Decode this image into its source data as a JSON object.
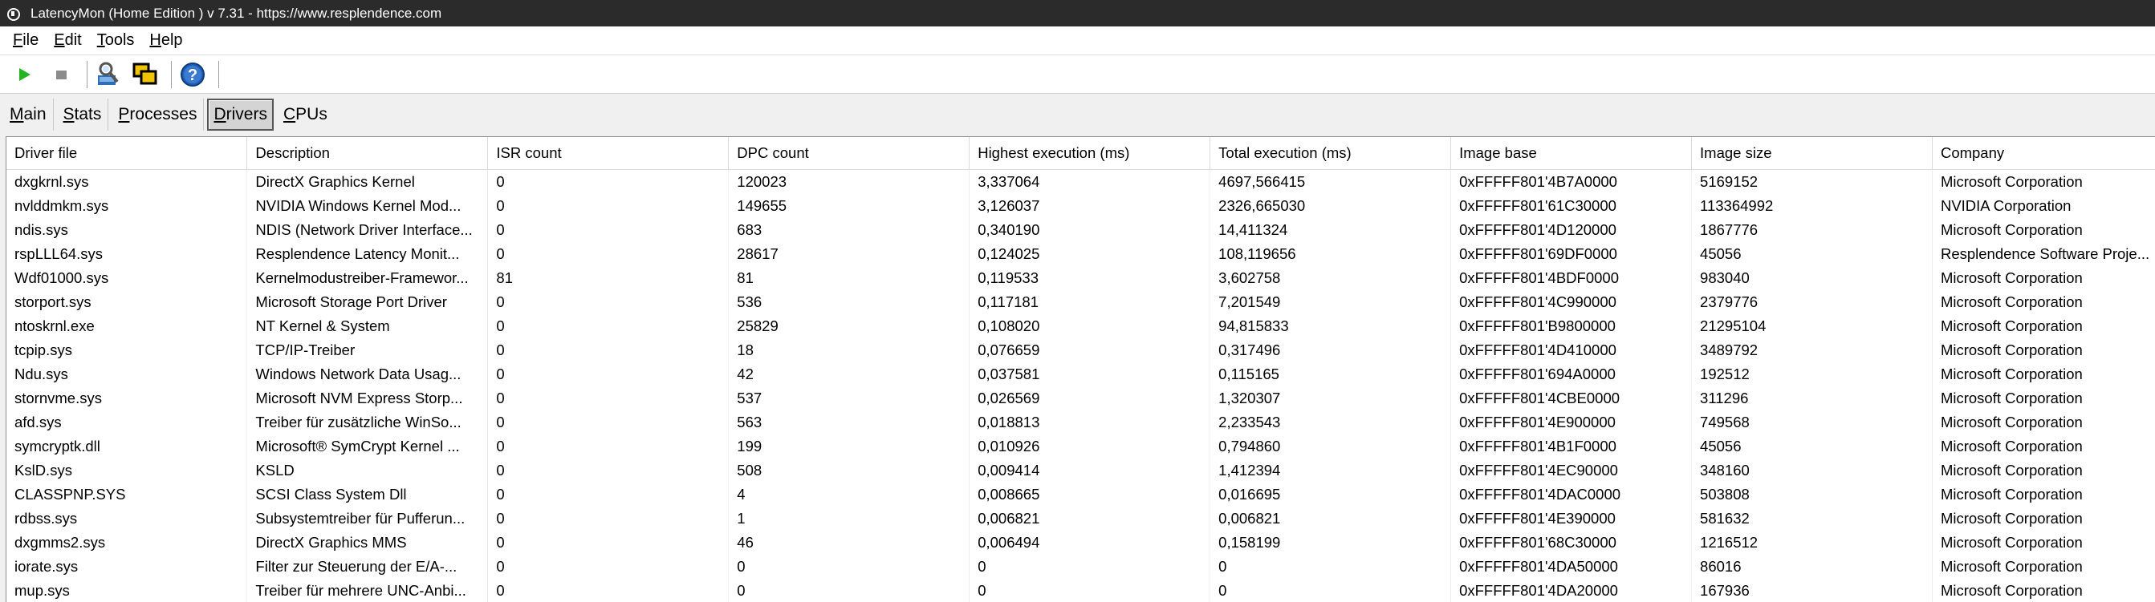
{
  "window": {
    "title": "LatencyMon  (Home Edition )  v 7.31 - https://www.resplendence.com"
  },
  "menu": [
    {
      "accel": "F",
      "rest": "ile"
    },
    {
      "accel": "E",
      "rest": "dit"
    },
    {
      "accel": "T",
      "rest": "ools"
    },
    {
      "accel": "H",
      "rest": "elp"
    }
  ],
  "toolbar": {
    "start_icon": "play-icon",
    "stop_icon": "stop-icon",
    "submit_icon": "report-icon",
    "windows_icon": "windows-icon",
    "help_icon": "help-icon"
  },
  "tabs": [
    {
      "accel": "M",
      "rest": "ain"
    },
    {
      "accel": "S",
      "rest": "tats"
    },
    {
      "accel": "P",
      "rest": "rocesses"
    },
    {
      "accel": "D",
      "rest": "rivers"
    },
    {
      "accel": "C",
      "rest": "PUs"
    }
  ],
  "active_tab": "Drivers",
  "columns": [
    "Driver file",
    "Description",
    "ISR count",
    "DPC count",
    "Highest execution (ms)",
    "Total execution (ms)",
    "Image base",
    "Image size",
    "Company"
  ],
  "rows": [
    [
      "dxgkrnl.sys",
      "DirectX Graphics Kernel",
      "0",
      "120023",
      "3,337064",
      "4697,566415",
      "0xFFFFF801'4B7A0000",
      "5169152",
      "Microsoft Corporation"
    ],
    [
      "nvlddmkm.sys",
      "NVIDIA Windows Kernel Mod...",
      "0",
      "149655",
      "3,126037",
      "2326,665030",
      "0xFFFFF801'61C30000",
      "113364992",
      "NVIDIA Corporation"
    ],
    [
      "ndis.sys",
      "NDIS (Network Driver Interface...",
      "0",
      "683",
      "0,340190",
      "14,411324",
      "0xFFFFF801'4D120000",
      "1867776",
      "Microsoft Corporation"
    ],
    [
      "rspLLL64.sys",
      "Resplendence Latency Monit...",
      "0",
      "28617",
      "0,124025",
      "108,119656",
      "0xFFFFF801'69DF0000",
      "45056",
      "Resplendence Software Proje..."
    ],
    [
      "Wdf01000.sys",
      "Kernelmodustreiber-Framewor...",
      "81",
      "81",
      "0,119533",
      "3,602758",
      "0xFFFFF801'4BDF0000",
      "983040",
      "Microsoft Corporation"
    ],
    [
      "storport.sys",
      "Microsoft Storage Port Driver",
      "0",
      "536",
      "0,117181",
      "7,201549",
      "0xFFFFF801'4C990000",
      "2379776",
      "Microsoft Corporation"
    ],
    [
      "ntoskrnl.exe",
      "NT Kernel & System",
      "0",
      "25829",
      "0,108020",
      "94,815833",
      "0xFFFFF801'B9800000",
      "21295104",
      "Microsoft Corporation"
    ],
    [
      "tcpip.sys",
      "TCP/IP-Treiber",
      "0",
      "18",
      "0,076659",
      "0,317496",
      "0xFFFFF801'4D410000",
      "3489792",
      "Microsoft Corporation"
    ],
    [
      "Ndu.sys",
      "Windows Network Data Usag...",
      "0",
      "42",
      "0,037581",
      "0,115165",
      "0xFFFFF801'694A0000",
      "192512",
      "Microsoft Corporation"
    ],
    [
      "stornvme.sys",
      "Microsoft NVM Express Storp...",
      "0",
      "537",
      "0,026569",
      "1,320307",
      "0xFFFFF801'4CBE0000",
      "311296",
      "Microsoft Corporation"
    ],
    [
      "afd.sys",
      "Treiber für zusätzliche WinSo...",
      "0",
      "563",
      "0,018813",
      "2,233543",
      "0xFFFFF801'4E900000",
      "749568",
      "Microsoft Corporation"
    ],
    [
      "symcryptk.dll",
      "Microsoft® SymCrypt Kernel ...",
      "0",
      "199",
      "0,010926",
      "0,794860",
      "0xFFFFF801'4B1F0000",
      "45056",
      "Microsoft Corporation"
    ],
    [
      "KslD.sys",
      "KSLD",
      "0",
      "508",
      "0,009414",
      "1,412394",
      "0xFFFFF801'4EC90000",
      "348160",
      "Microsoft Corporation"
    ],
    [
      "CLASSPNP.SYS",
      "SCSI Class System Dll",
      "0",
      "4",
      "0,008665",
      "0,016695",
      "0xFFFFF801'4DAC0000",
      "503808",
      "Microsoft Corporation"
    ],
    [
      "rdbss.sys",
      "Subsystemtreiber für Pufferun...",
      "0",
      "1",
      "0,006821",
      "0,006821",
      "0xFFFFF801'4E390000",
      "581632",
      "Microsoft Corporation"
    ],
    [
      "dxgmms2.sys",
      "DirectX Graphics MMS",
      "0",
      "46",
      "0,006494",
      "0,158199",
      "0xFFFFF801'68C30000",
      "1216512",
      "Microsoft Corporation"
    ],
    [
      "iorate.sys",
      "Filter zur Steuerung der E/A-...",
      "0",
      "0",
      "0",
      "0",
      "0xFFFFF801'4DA50000",
      "86016",
      "Microsoft Corporation"
    ],
    [
      "mup.sys",
      "Treiber für mehrere UNC-Anbi...",
      "0",
      "0",
      "0",
      "0",
      "0xFFFFF801'4DA20000",
      "167936",
      "Microsoft Corporation"
    ]
  ]
}
